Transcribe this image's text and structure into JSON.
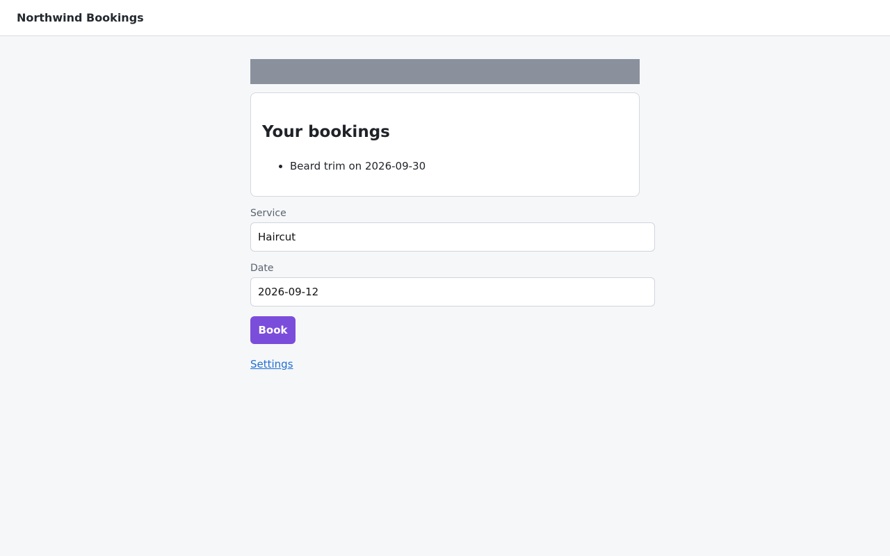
{
  "header": {
    "brand": "Northwind Bookings"
  },
  "bookings_card": {
    "title": "Your bookings",
    "items": [
      {
        "label": "Beard trim on 2026-09-30"
      }
    ]
  },
  "form": {
    "service": {
      "label": "Service",
      "value": "Haircut"
    },
    "date": {
      "label": "Date",
      "value": "2026-09-12"
    },
    "submit_label": "Book"
  },
  "links": {
    "settings": "Settings"
  },
  "colors": {
    "accent": "#7b4ddb",
    "link": "#1f6fd1",
    "banner": "#8a919c",
    "background": "#f6f7f9"
  }
}
